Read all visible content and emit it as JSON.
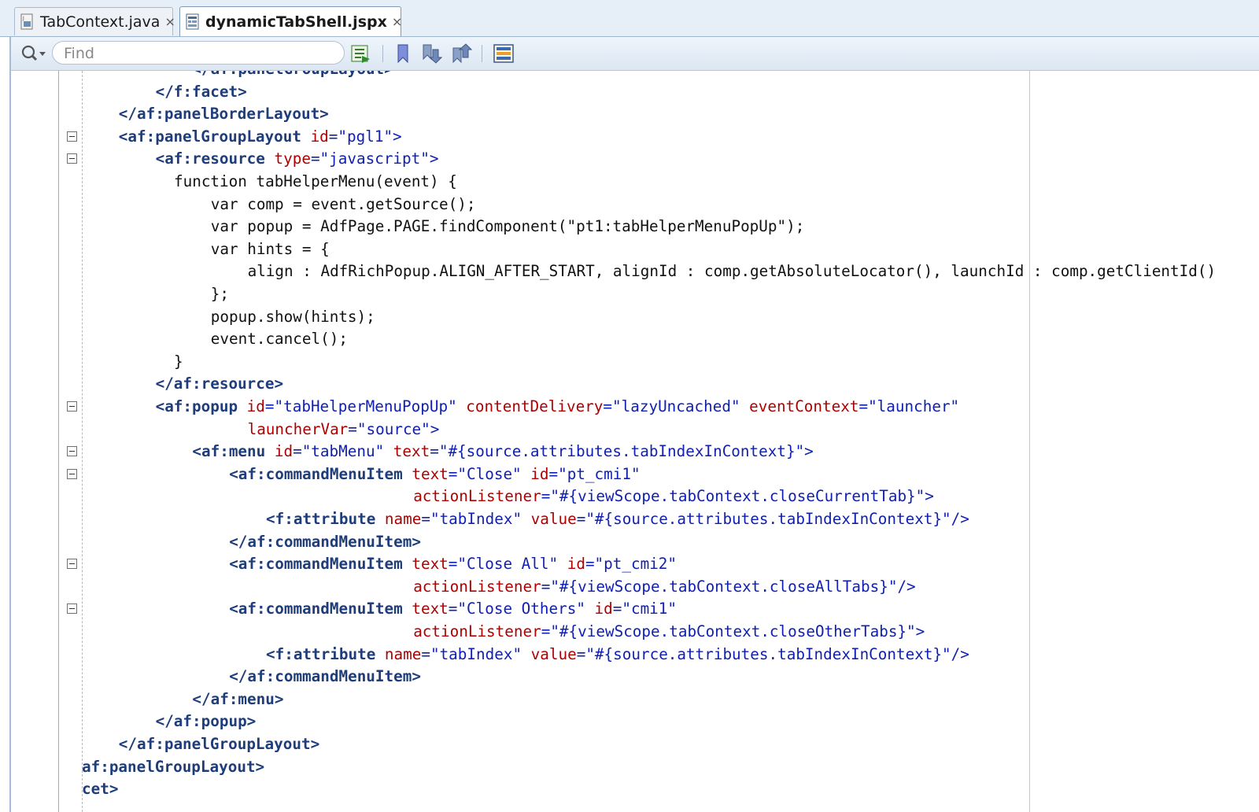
{
  "tabs": [
    {
      "label": "TabContext.java",
      "close": "×",
      "active": false
    },
    {
      "label": "dynamicTabShell.jspx",
      "close": "×",
      "active": true
    }
  ],
  "toolbar": {
    "find_placeholder": "Find"
  },
  "code_lines": [
    {
      "indent": 12,
      "foldable": false,
      "segments": [
        {
          "t": "tg",
          "v": "</af:panelGroupLayout>"
        }
      ]
    },
    {
      "indent": 8,
      "foldable": false,
      "segments": [
        {
          "t": "tg",
          "v": "</f:facet>"
        }
      ]
    },
    {
      "indent": 4,
      "foldable": false,
      "segments": [
        {
          "t": "tg",
          "v": "</af:panelBorderLayout>"
        }
      ]
    },
    {
      "indent": 4,
      "foldable": true,
      "segments": [
        {
          "t": "tg",
          "v": "<af:panelGroupLayout"
        },
        {
          "t": "at",
          "v": " id"
        },
        {
          "t": "vl",
          "v": "=\"pgl1\">"
        }
      ]
    },
    {
      "indent": 8,
      "foldable": true,
      "segments": [
        {
          "t": "tg",
          "v": "<af:resource"
        },
        {
          "t": "at",
          "v": " type"
        },
        {
          "t": "vl",
          "v": "=\"javascript\">"
        }
      ]
    },
    {
      "indent": 10,
      "foldable": false,
      "segments": [
        {
          "t": "pl",
          "v": "function tabHelperMenu(event) {"
        }
      ]
    },
    {
      "indent": 14,
      "foldable": false,
      "segments": [
        {
          "t": "pl",
          "v": "var comp = event.getSource();"
        }
      ]
    },
    {
      "indent": 14,
      "foldable": false,
      "segments": [
        {
          "t": "pl",
          "v": "var popup = AdfPage.PAGE.findComponent(\"pt1:tabHelperMenuPopUp\");"
        }
      ]
    },
    {
      "indent": 14,
      "foldable": false,
      "segments": [
        {
          "t": "pl",
          "v": "var hints = {"
        }
      ]
    },
    {
      "indent": 18,
      "foldable": false,
      "segments": [
        {
          "t": "pl",
          "v": "align : AdfRichPopup.ALIGN_AFTER_START, alignId : comp.getAbsoluteLocator(), launchId : comp.getClientId()"
        }
      ]
    },
    {
      "indent": 14,
      "foldable": false,
      "segments": [
        {
          "t": "pl",
          "v": "};"
        }
      ]
    },
    {
      "indent": 14,
      "foldable": false,
      "segments": [
        {
          "t": "pl",
          "v": "popup.show(hints);"
        }
      ]
    },
    {
      "indent": 14,
      "foldable": false,
      "segments": [
        {
          "t": "pl",
          "v": "event.cancel();"
        }
      ]
    },
    {
      "indent": 10,
      "foldable": false,
      "segments": [
        {
          "t": "pl",
          "v": "}"
        }
      ]
    },
    {
      "indent": 8,
      "foldable": false,
      "segments": [
        {
          "t": "tg",
          "v": "</af:resource>"
        }
      ]
    },
    {
      "indent": 8,
      "foldable": true,
      "segments": [
        {
          "t": "tg",
          "v": "<af:popup"
        },
        {
          "t": "at",
          "v": " id"
        },
        {
          "t": "vl",
          "v": "=\"tabHelperMenuPopUp\""
        },
        {
          "t": "at",
          "v": " contentDelivery"
        },
        {
          "t": "vl",
          "v": "=\"lazyUncached\""
        },
        {
          "t": "at",
          "v": " eventContext"
        },
        {
          "t": "vl",
          "v": "=\"launcher\""
        }
      ]
    },
    {
      "indent": 18,
      "foldable": false,
      "segments": [
        {
          "t": "at",
          "v": "launcherVar"
        },
        {
          "t": "vl",
          "v": "=\"source\">"
        }
      ]
    },
    {
      "indent": 12,
      "foldable": true,
      "segments": [
        {
          "t": "tg",
          "v": "<af:menu"
        },
        {
          "t": "at",
          "v": " id"
        },
        {
          "t": "vl",
          "v": "=\"tabMenu\""
        },
        {
          "t": "at",
          "v": " text"
        },
        {
          "t": "vl",
          "v": "=\"#{source.attributes.tabIndexInContext}\">"
        }
      ]
    },
    {
      "indent": 16,
      "foldable": true,
      "segments": [
        {
          "t": "tg",
          "v": "<af:commandMenuItem"
        },
        {
          "t": "at",
          "v": " text"
        },
        {
          "t": "vl",
          "v": "=\"Close\""
        },
        {
          "t": "at",
          "v": " id"
        },
        {
          "t": "vl",
          "v": "=\"pt_cmi1\""
        }
      ]
    },
    {
      "indent": 36,
      "foldable": false,
      "segments": [
        {
          "t": "at",
          "v": "actionListener"
        },
        {
          "t": "vl",
          "v": "=\"#{viewScope.tabContext.closeCurrentTab}\">"
        }
      ]
    },
    {
      "indent": 20,
      "foldable": false,
      "segments": [
        {
          "t": "tg",
          "v": "<f:attribute"
        },
        {
          "t": "at",
          "v": " name"
        },
        {
          "t": "vl",
          "v": "=\"tabIndex\""
        },
        {
          "t": "at",
          "v": " value"
        },
        {
          "t": "vl",
          "v": "=\"#{source.attributes.tabIndexInContext}\"/>"
        }
      ]
    },
    {
      "indent": 16,
      "foldable": false,
      "segments": [
        {
          "t": "tg",
          "v": "</af:commandMenuItem>"
        }
      ]
    },
    {
      "indent": 16,
      "foldable": true,
      "segments": [
        {
          "t": "tg",
          "v": "<af:commandMenuItem"
        },
        {
          "t": "at",
          "v": " text"
        },
        {
          "t": "vl",
          "v": "=\"Close All\""
        },
        {
          "t": "at",
          "v": " id"
        },
        {
          "t": "vl",
          "v": "=\"pt_cmi2\""
        }
      ]
    },
    {
      "indent": 36,
      "foldable": false,
      "segments": [
        {
          "t": "at",
          "v": "actionListener"
        },
        {
          "t": "vl",
          "v": "=\"#{viewScope.tabContext.closeAllTabs}\"/>"
        }
      ]
    },
    {
      "indent": 16,
      "foldable": true,
      "segments": [
        {
          "t": "tg",
          "v": "<af:commandMenuItem"
        },
        {
          "t": "at",
          "v": " text"
        },
        {
          "t": "vl",
          "v": "=\"Close Others\""
        },
        {
          "t": "at",
          "v": " id"
        },
        {
          "t": "vl",
          "v": "=\"cmi1\""
        }
      ]
    },
    {
      "indent": 36,
      "foldable": false,
      "segments": [
        {
          "t": "at",
          "v": "actionListener"
        },
        {
          "t": "vl",
          "v": "=\"#{viewScope.tabContext.closeOtherTabs}\">"
        }
      ]
    },
    {
      "indent": 20,
      "foldable": false,
      "segments": [
        {
          "t": "tg",
          "v": "<f:attribute"
        },
        {
          "t": "at",
          "v": " name"
        },
        {
          "t": "vl",
          "v": "=\"tabIndex\""
        },
        {
          "t": "at",
          "v": " value"
        },
        {
          "t": "vl",
          "v": "=\"#{source.attributes.tabIndexInContext}\"/>"
        }
      ]
    },
    {
      "indent": 16,
      "foldable": false,
      "segments": [
        {
          "t": "tg",
          "v": "</af:commandMenuItem>"
        }
      ]
    },
    {
      "indent": 12,
      "foldable": false,
      "segments": [
        {
          "t": "tg",
          "v": "</af:menu>"
        }
      ]
    },
    {
      "indent": 8,
      "foldable": false,
      "segments": [
        {
          "t": "tg",
          "v": "</af:popup>"
        }
      ]
    },
    {
      "indent": 4,
      "foldable": false,
      "segments": [
        {
          "t": "tg",
          "v": "</af:panelGroupLayout>"
        }
      ]
    },
    {
      "indent": 0,
      "foldable": false,
      "segments": [
        {
          "t": "tg",
          "v": "af:panelGroupLayout>"
        }
      ]
    },
    {
      "indent": 0,
      "foldable": false,
      "segments": [
        {
          "t": "tg",
          "v": "cet>"
        }
      ]
    }
  ]
}
